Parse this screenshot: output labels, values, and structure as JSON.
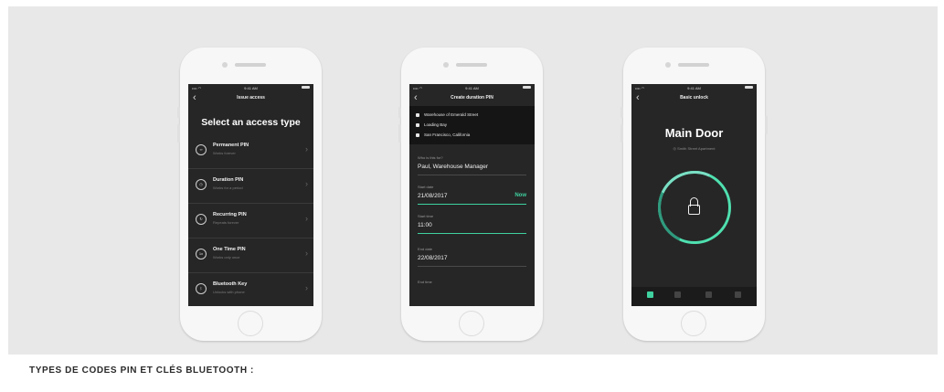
{
  "caption": "TYPES DE CODES PIN ET CLÉS BLUETOOTH :",
  "phone1": {
    "status_time": "9:41 AM",
    "title": "Issue access",
    "heading": "Select an access type",
    "options": [
      {
        "name": "Permanent PIN",
        "desc": "Works forever",
        "icon": "infinity-icon",
        "glyph": "∞"
      },
      {
        "name": "Duration PIN",
        "desc": "Works for a period",
        "icon": "clock-icon",
        "glyph": "◷"
      },
      {
        "name": "Recurring PIN",
        "desc": "Repeats forever",
        "icon": "repeat-icon",
        "glyph": "↻"
      },
      {
        "name": "One Time PIN",
        "desc": "Works only once",
        "icon": "one-time-icon",
        "glyph": "1x"
      },
      {
        "name": "Bluetooth Key",
        "desc": "Unlocks with phone",
        "icon": "bluetooth-icon",
        "glyph": "ᛒ"
      }
    ]
  },
  "phone2": {
    "status_time": "9:41 AM",
    "title": "Create duration PIN",
    "address": [
      "Warehouse of Emerald Street",
      "Loading Bay",
      "San Francisco, California"
    ],
    "fields": [
      {
        "label": "Who is this for?",
        "value": "Paul, Warehouse Manager"
      },
      {
        "label": "Start date",
        "value": "21/08/2017",
        "action": "Now"
      },
      {
        "label": "Start time",
        "value": "11:00"
      },
      {
        "label": "End date",
        "value": "22/08/2017"
      },
      {
        "label": "End time",
        "value": ""
      }
    ]
  },
  "phone3": {
    "status_time": "9:41 AM",
    "title": "Basic unlock",
    "lock_name": "Main Door",
    "location": "Smith Street Apartment",
    "accent": "#3fd19f",
    "tabs": [
      "lock-icon",
      "send-icon",
      "list-icon",
      "settings-icon"
    ]
  }
}
